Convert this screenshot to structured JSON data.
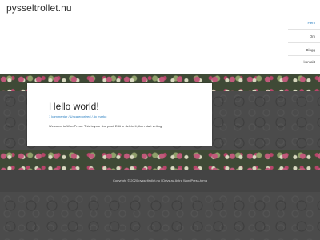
{
  "site": {
    "title": "pysseltrollet.nu"
  },
  "nav": {
    "items": [
      {
        "label": "Hem",
        "active": true
      },
      {
        "label": "Om",
        "active": false
      },
      {
        "label": "Blogg",
        "active": false
      },
      {
        "label": "kontakt",
        "active": false
      }
    ]
  },
  "post": {
    "title": "Hello world!",
    "meta": "1 kommentar / Uncategorized / Av marko",
    "excerpt": "Welcome to WordPress. This is your first post. Edit or delete it, then start writing!"
  },
  "footer": {
    "text": "Copyright © 2020 pysseltrollet.nu | Drivs av Astra WordPress-tema"
  },
  "colors": {
    "accent": "#2a7fc1",
    "footer_bg": "#444444",
    "page_bg": "#4b4b4b"
  }
}
